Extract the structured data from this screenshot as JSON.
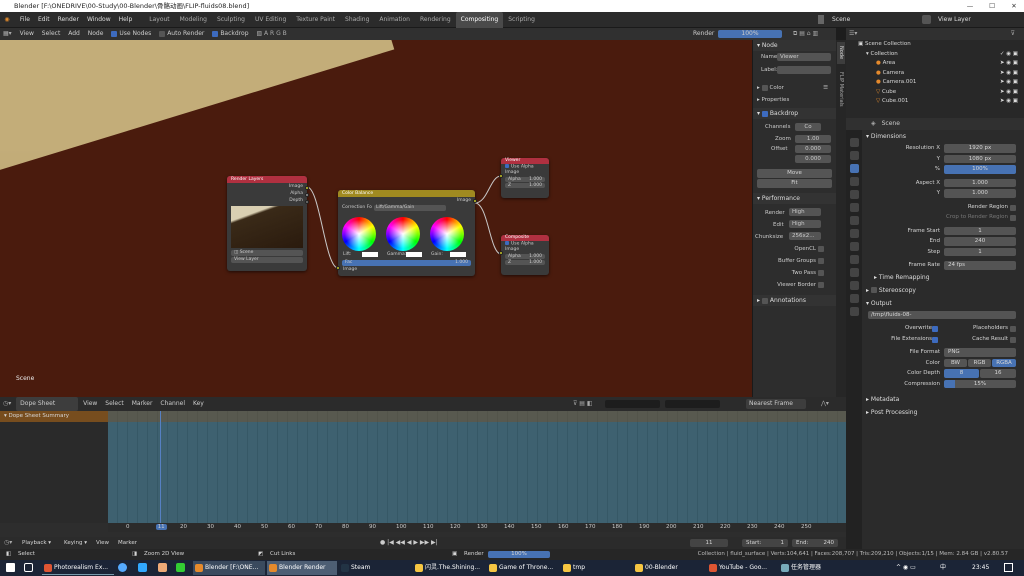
{
  "window": {
    "title": "Blender [F:\\ONEDRIVE\\00-Study\\00-Blender\\骨骼动画\\FLIP-fluids08.blend]"
  },
  "menu": [
    "File",
    "Edit",
    "Render",
    "Window",
    "Help"
  ],
  "workspaces": [
    "Layout",
    "Modeling",
    "Sculpting",
    "UV Editing",
    "Texture Paint",
    "Shading",
    "Animation",
    "Rendering",
    "Compositing",
    "Scripting"
  ],
  "active_workspace": "Compositing",
  "scene": {
    "name": "Scene",
    "view_layer": "View Layer"
  },
  "node_header": {
    "items": [
      "View",
      "Select",
      "Add",
      "Node"
    ],
    "use_nodes": "Use Nodes",
    "auto_render": "Auto Render",
    "backdrop": "Backdrop",
    "render": "Render",
    "zoom": "100%"
  },
  "canvas": {
    "scene_label": "Scene"
  },
  "nodes": {
    "render_layers": {
      "title": "Render Layers",
      "outputs": [
        "Image",
        "Alpha",
        "Depth"
      ],
      "scene": "Scene",
      "view_layer": "View Layer"
    },
    "color_balance": {
      "title": "Color Balance",
      "output": "Image",
      "correction": "Correction Fo",
      "method": "Lift/Gamma/Gain",
      "lift": "Lift:",
      "gamma": "Gamma:",
      "gain": "Gain:",
      "fac": "Fac",
      "fac_val": "1.000",
      "input": "Image"
    },
    "viewer": {
      "title": "Viewer",
      "use_alpha": "Use Alpha",
      "image": "Image",
      "alpha": "Alpha",
      "alpha_val": "1.000",
      "z": "Z",
      "z_val": "1.000"
    },
    "composite": {
      "title": "Composite",
      "use_alpha": "Use Alpha",
      "image": "Image",
      "alpha": "Alpha",
      "alpha_val": "1.000",
      "z": "Z",
      "z_val": "1.000"
    }
  },
  "sidebar": {
    "node_section": "Node",
    "name_label": "Name:",
    "name_val": "Viewer",
    "label_label": "Label:",
    "color": "Color",
    "properties": "Properties",
    "backdrop": "Backdrop",
    "channels": "Channels",
    "channels_val": "Co",
    "zoom": "Zoom",
    "zoom_val": "1.00",
    "offset": "Offset",
    "offset_x": "0.000",
    "offset_y": "0.000",
    "move": "Move",
    "fit": "Fit",
    "performance": "Performance",
    "render": "Render",
    "render_val": "High",
    "edit": "Edit",
    "edit_val": "High",
    "chunksize": "Chunksize",
    "chunksize_val": "256x2...",
    "opencl": "OpenCL",
    "buffer_groups": "Buffer Groups",
    "two_pass": "Two Pass",
    "viewer_border": "Viewer Border",
    "annotations": "Annotations",
    "tabs": [
      "Node",
      "FLIP Materials"
    ]
  },
  "outliner": {
    "root": "Scene Collection",
    "items": [
      "Collection",
      "Area",
      "Camera",
      "Camera.001",
      "Cube",
      "Cube.001"
    ]
  },
  "properties": {
    "scene": "Scene",
    "dimensions": "Dimensions",
    "rows": [
      {
        "label": "Resolution X",
        "value": "1920 px"
      },
      {
        "label": "Y",
        "value": "1080 px"
      },
      {
        "label": "%",
        "value": "100%"
      },
      {
        "label": "Aspect X",
        "value": "1.000"
      },
      {
        "label": "Y",
        "value": "1.000"
      }
    ],
    "render_region": "Render Region",
    "crop": "Crop to Render Region",
    "frames": [
      {
        "label": "Frame Start",
        "value": "1"
      },
      {
        "label": "End",
        "value": "240"
      },
      {
        "label": "Step",
        "value": "1"
      }
    ],
    "frame_rate": "Frame Rate",
    "frame_rate_val": "24 fps",
    "time_remap": "Time Remapping",
    "stereo": "Stereoscopy",
    "output": "Output",
    "path": "/tmp\\fluids-08-",
    "overwrite": "Overwrite",
    "placeholders": "Placeholders",
    "file_ext": "File Extensions",
    "cache_result": "Cache Result",
    "file_format": "File Format",
    "file_format_val": "PNG",
    "color": "Color",
    "color_opts": [
      "BW",
      "RGB",
      "RGBA"
    ],
    "color_depth": "Color Depth",
    "depth_opts": [
      "8",
      "16"
    ],
    "compression": "Compression",
    "compression_val": "15%",
    "metadata": "Metadata",
    "post": "Post Processing"
  },
  "dopesheet": {
    "mode": "Dope Sheet",
    "items": [
      "View",
      "Select",
      "Marker",
      "Channel",
      "Key"
    ],
    "summary": "Dope Sheet Summary",
    "interp": "Nearest Frame",
    "ticks": [
      "0",
      "11",
      "20",
      "30",
      "40",
      "50",
      "60",
      "70",
      "80",
      "90",
      "100",
      "110",
      "120",
      "130",
      "140",
      "150",
      "160",
      "170",
      "180",
      "190",
      "200",
      "210",
      "220",
      "230",
      "240",
      "250"
    ]
  },
  "timeline": {
    "items": [
      "Playback",
      "Keying",
      "View",
      "Marker"
    ],
    "current": "11",
    "start_label": "Start:",
    "start": "1",
    "end_label": "End:",
    "end": "240"
  },
  "status": {
    "select": "Select",
    "zoom2d": "Zoom 2D View",
    "cut": "Cut Links",
    "render": "Render",
    "render_pct": "100%",
    "stats": "Collection | fluid_surface | Verts:104,641 | Faces:208,707 | Tris:209,210 | Objects:1/15 | Mem: 2.84 GB | v2.80.57"
  },
  "taskbar": {
    "apps": [
      "Photorealism Ex...",
      "Blender [F:\\ONE...",
      "Blender Render",
      "Steam",
      "闪灵.The.Shining...",
      "Game of Throne...",
      "tmp",
      "00-Blender",
      "YouTube - Goo...",
      "任务管理器"
    ],
    "time": "23:45",
    "lang": "中"
  },
  "colors": {
    "accent": "#4772b3",
    "active_ws": "#4a4a4a",
    "canvas": "#4a1b0d",
    "node_red": "#b03040",
    "node_yellow": "#a08a20"
  }
}
